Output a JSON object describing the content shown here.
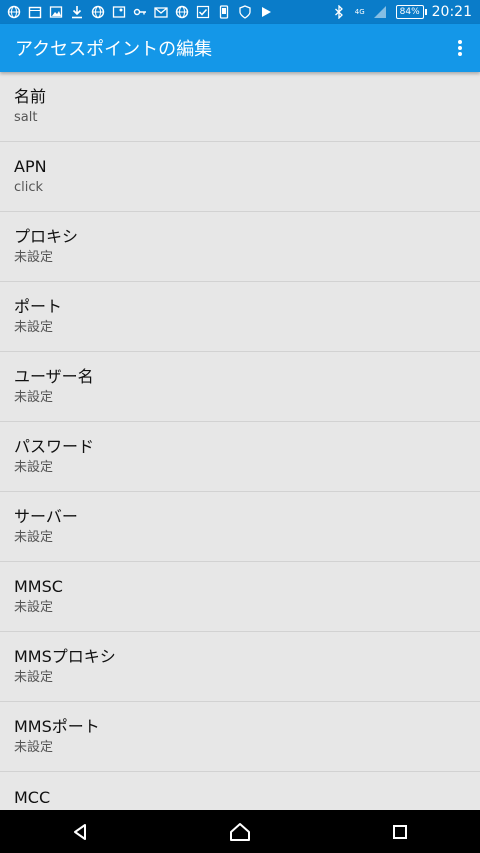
{
  "status_bar": {
    "time": "20:21",
    "battery": "84%",
    "network": "4G",
    "icons": [
      "globe-icon",
      "calendar-icon",
      "image-icon",
      "download-icon",
      "globe-icon",
      "image-edit-icon",
      "key-icon",
      "gmail-icon",
      "globe-icon",
      "check-icon",
      "phone-icon",
      "shield-icon",
      "play-icon"
    ],
    "right_icons": [
      "bluetooth-icon",
      "signal-icon",
      "battery-icon"
    ]
  },
  "app_bar": {
    "title": "アクセスポイントの編集",
    "menu_icon": "more-vert-icon"
  },
  "settings": [
    {
      "title": "名前",
      "value": "salt"
    },
    {
      "title": "APN",
      "value": "click"
    },
    {
      "title": "プロキシ",
      "value": "未設定"
    },
    {
      "title": "ポート",
      "value": "未設定"
    },
    {
      "title": "ユーザー名",
      "value": "未設定"
    },
    {
      "title": "パスワード",
      "value": "未設定"
    },
    {
      "title": "サーバー",
      "value": "未設定"
    },
    {
      "title": "MMSC",
      "value": "未設定"
    },
    {
      "title": "MMSプロキシ",
      "value": "未設定"
    },
    {
      "title": "MMSポート",
      "value": "未設定"
    },
    {
      "title": "MCC",
      "value": ""
    }
  ],
  "nav_bar": {
    "buttons": [
      "back-icon",
      "home-icon",
      "recents-icon"
    ]
  }
}
